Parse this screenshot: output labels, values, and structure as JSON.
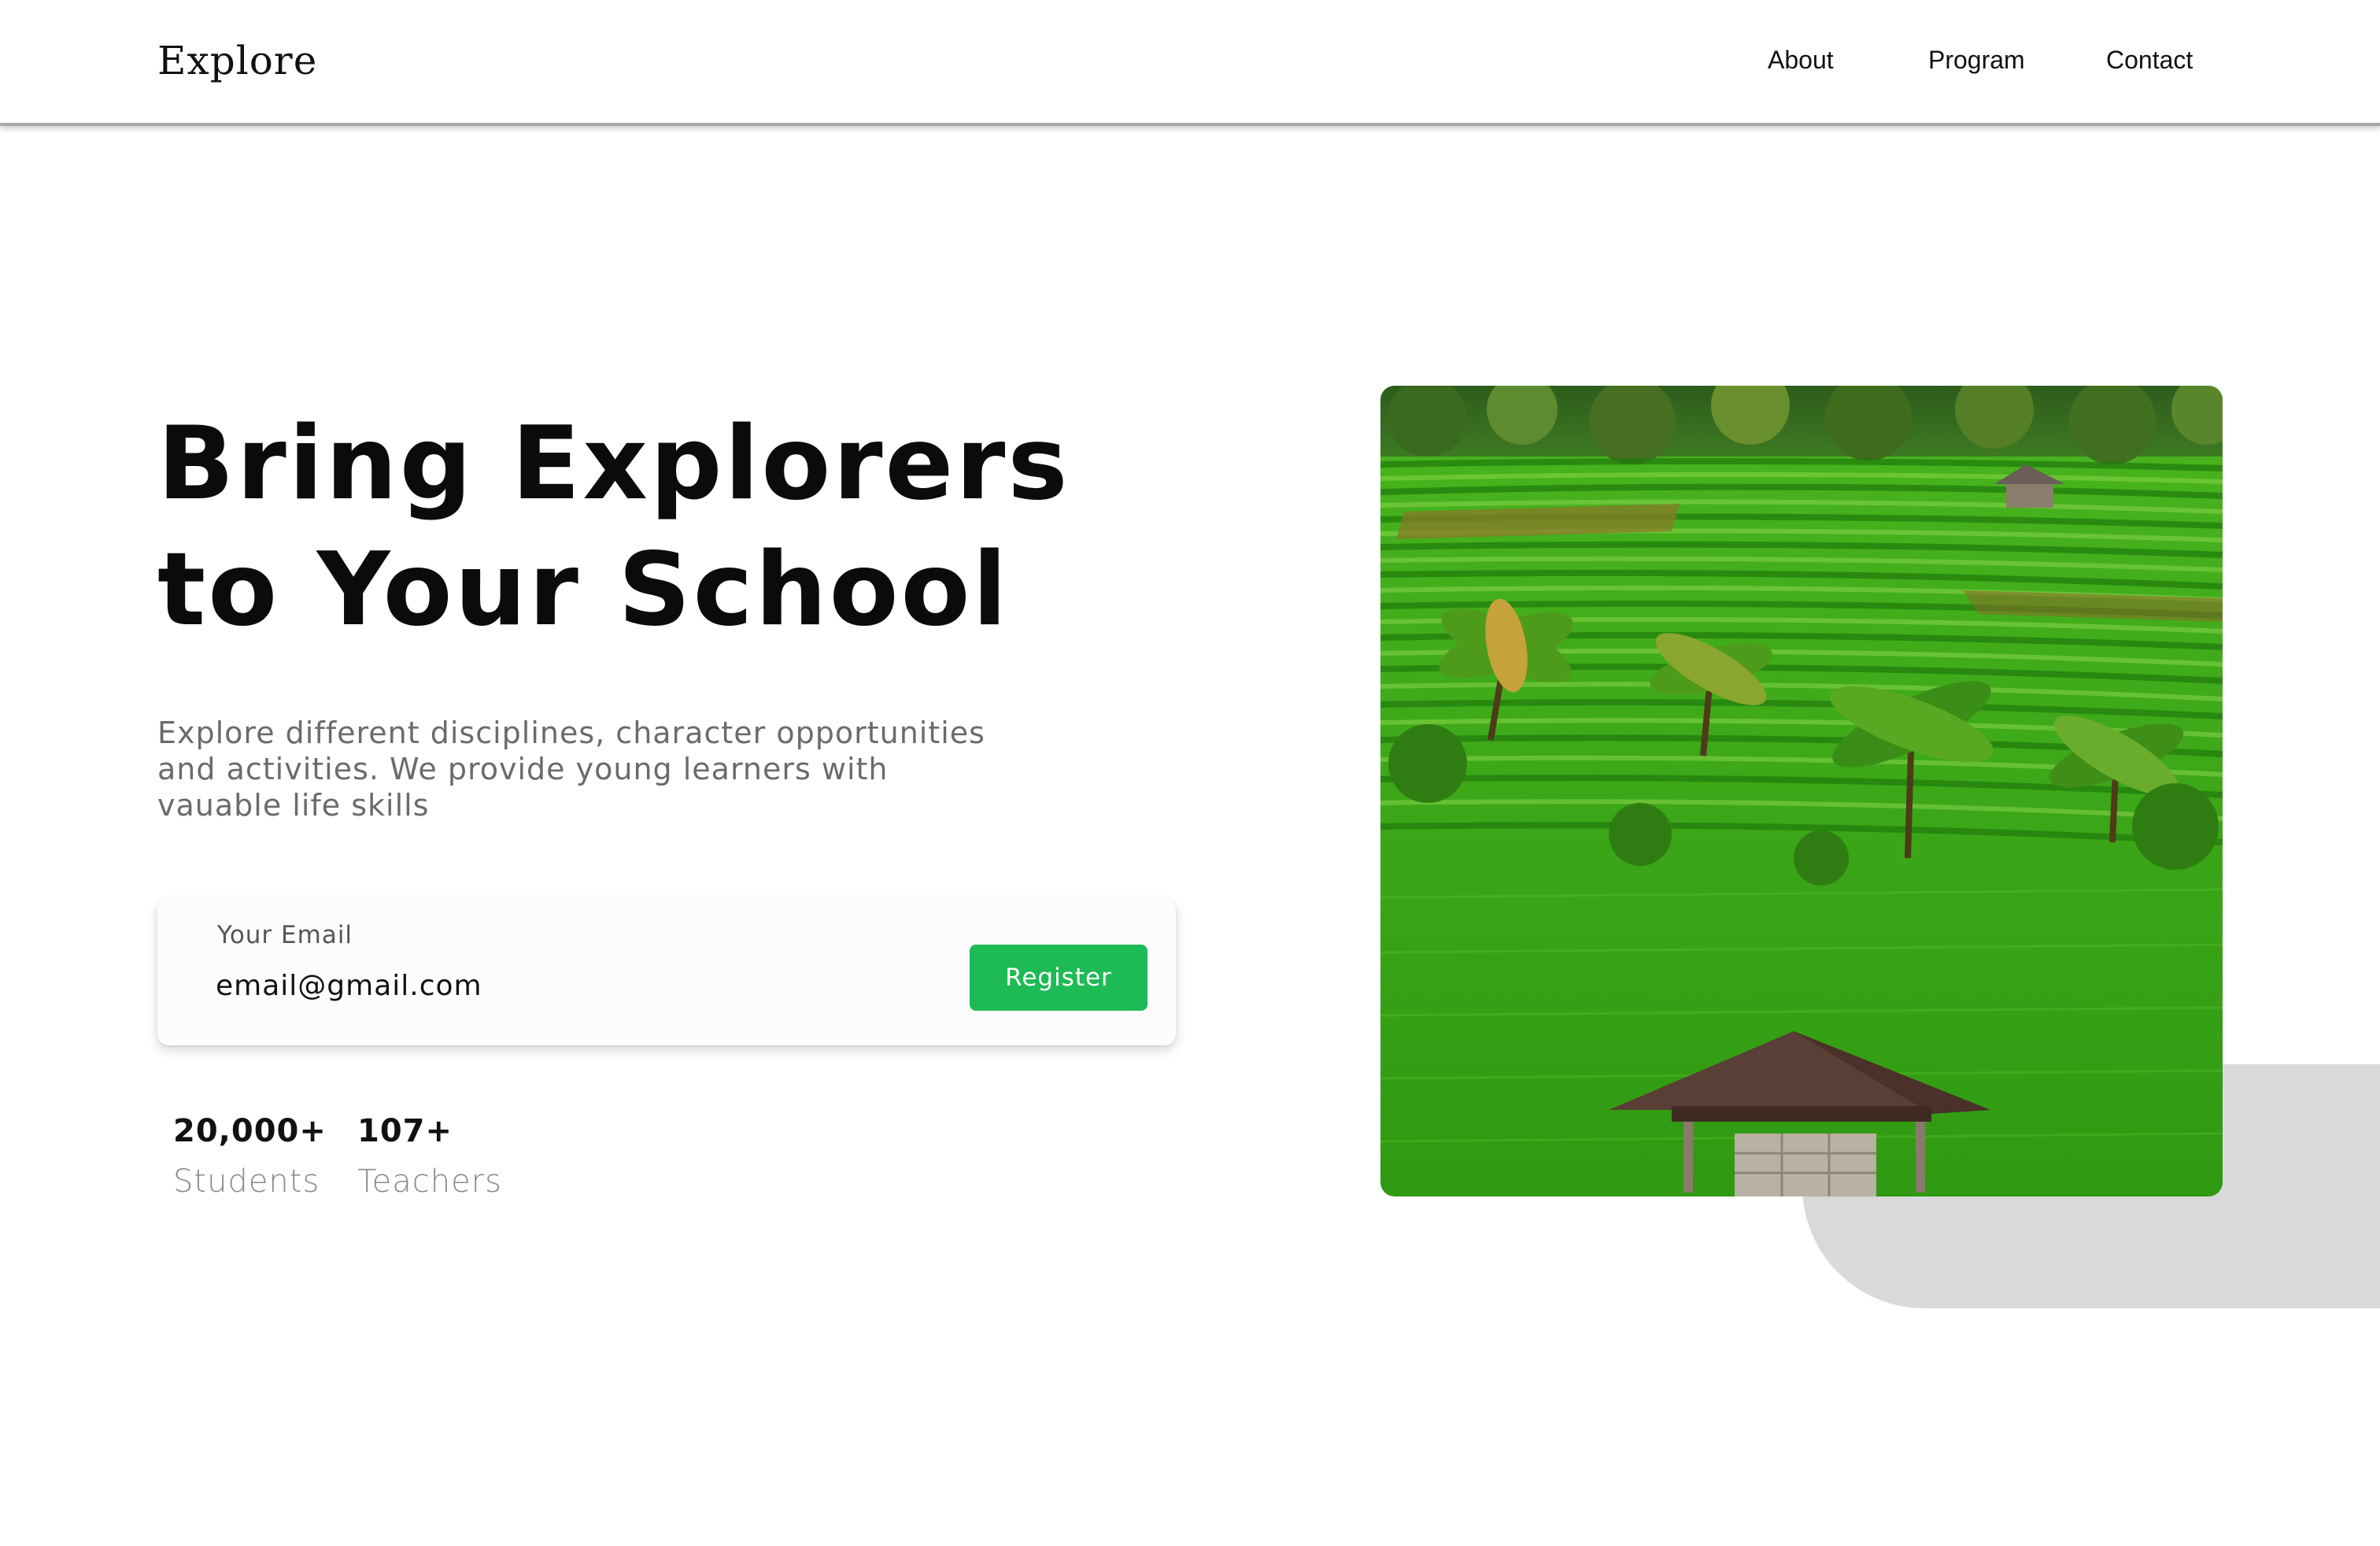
{
  "header": {
    "logo": "Explore",
    "nav": [
      {
        "label": "About"
      },
      {
        "label": "Program"
      },
      {
        "label": "Contact"
      }
    ]
  },
  "hero": {
    "title_lines": [
      "Bring Explorers",
      "to Your School"
    ],
    "description": "Explore different disciplines, character opportunities and activities. We provide young learners with vauable life skills",
    "image_description": "rice terraces photo"
  },
  "signup": {
    "label": "Your Email",
    "value": "email@gmail.com",
    "button_label": "Register"
  },
  "stats": [
    {
      "value": "20,000+",
      "label": "Students"
    },
    {
      "value": "107+",
      "label": "Teachers"
    }
  ],
  "colors": {
    "accent": "#1dba55",
    "decor_grey": "#d9d9d9",
    "text_dark": "#0b0b0b",
    "text_muted": "#6b6b6b"
  }
}
